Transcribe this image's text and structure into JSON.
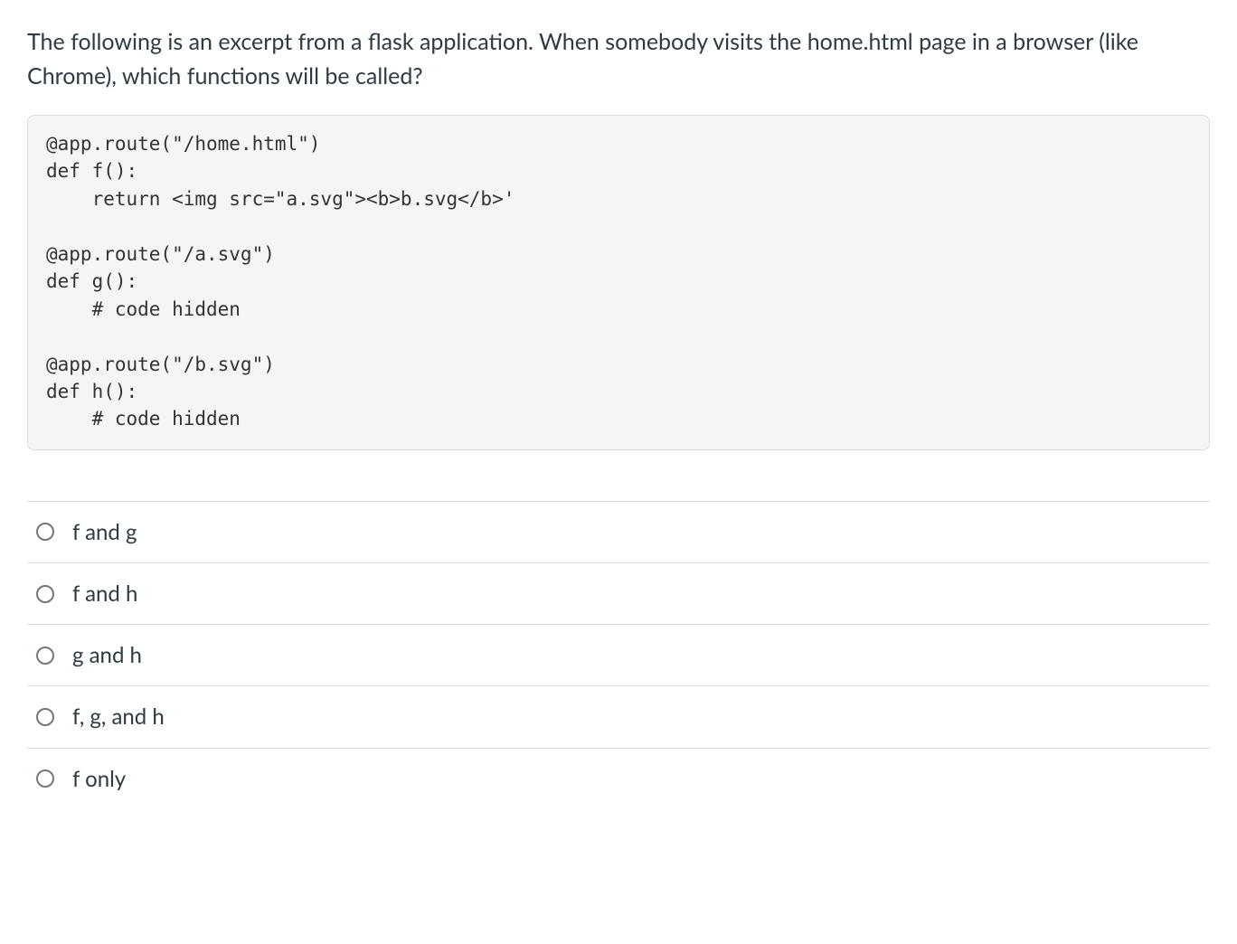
{
  "question": {
    "prompt": "The following is an excerpt from a flask application. When somebody visits the home.html page in a browser (like Chrome), which functions will be called?",
    "code": "@app.route(\"/home.html\")\ndef f():\n    return <img src=\"a.svg\"><b>b.svg</b>'\n\n@app.route(\"/a.svg\")\ndef g():\n    # code hidden\n\n@app.route(\"/b.svg\")\ndef h():\n    # code hidden"
  },
  "options": [
    {
      "label": "f and g"
    },
    {
      "label": "f and h"
    },
    {
      "label": "g and h"
    },
    {
      "label": "f, g, and h"
    },
    {
      "label": "f only"
    }
  ]
}
